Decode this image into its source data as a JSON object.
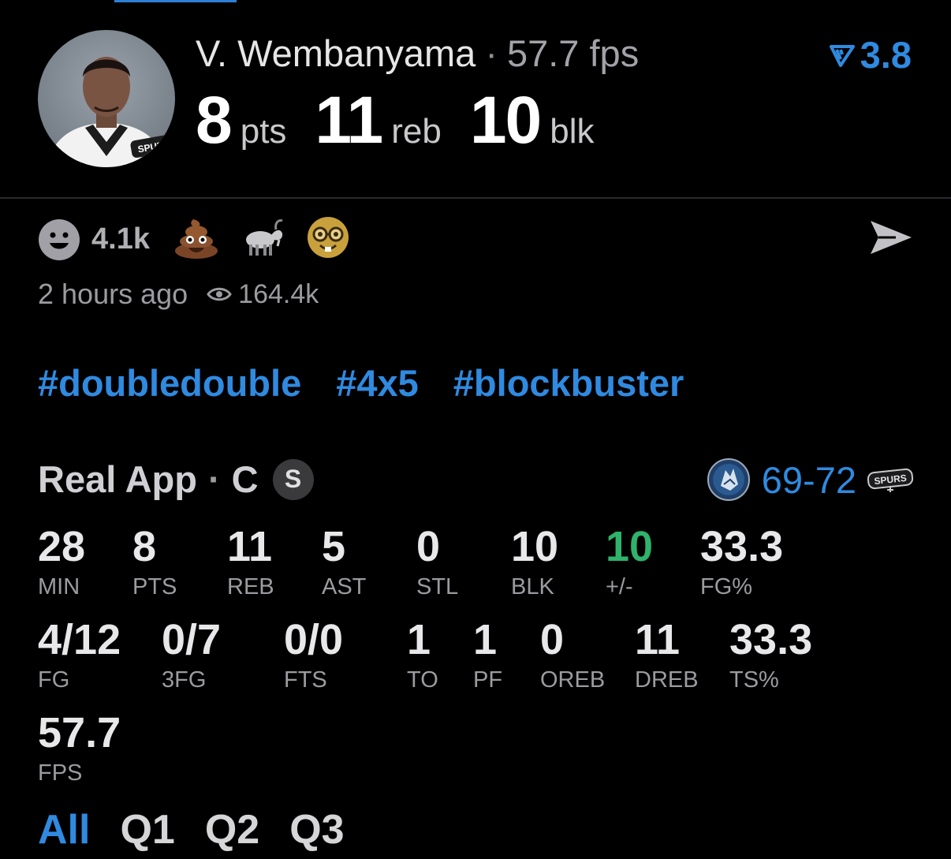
{
  "header": {
    "player_name": "V. Wembanyama",
    "fps_label": "57.7 fps",
    "rating": "3.8",
    "headline": [
      {
        "value": "8",
        "unit": "pts"
      },
      {
        "value": "11",
        "unit": "reb"
      },
      {
        "value": "10",
        "unit": "blk"
      }
    ]
  },
  "social": {
    "reaction_count": "4.1k",
    "time_ago": "2 hours ago",
    "views": "164.4k",
    "emojis": [
      "poop-emoji",
      "goat-emoji",
      "nerd-face-emoji"
    ]
  },
  "tags": [
    "#doubledouble",
    "#4x5",
    "#blockbuster"
  ],
  "game": {
    "source": "Real App",
    "position": "C",
    "badge": "S",
    "score": "69-72",
    "home_team_icon": "timberwolves-logo",
    "away_team_icon": "spurs-logo"
  },
  "stats_row1": [
    {
      "value": "28",
      "label": "MIN"
    },
    {
      "value": "8",
      "label": "PTS"
    },
    {
      "value": "11",
      "label": "REB"
    },
    {
      "value": "5",
      "label": "AST"
    },
    {
      "value": "0",
      "label": "STL"
    },
    {
      "value": "10",
      "label": "BLK"
    },
    {
      "value": "10",
      "label": "+/-"
    },
    {
      "value": "33.3",
      "label": "FG%"
    }
  ],
  "stats_row2": [
    {
      "value": "4/12",
      "label": "FG"
    },
    {
      "value": "0/7",
      "label": "3FG"
    },
    {
      "value": "0/0",
      "label": "FTS"
    },
    {
      "value": "1",
      "label": "TO"
    },
    {
      "value": "1",
      "label": "PF"
    },
    {
      "value": "0",
      "label": "OREB"
    },
    {
      "value": "11",
      "label": "DREB"
    },
    {
      "value": "33.3",
      "label": "TS%"
    }
  ],
  "stats_row3": [
    {
      "value": "57.7",
      "label": "FPS"
    }
  ],
  "quarters": {
    "items": [
      "All",
      "Q1",
      "Q2",
      "Q3"
    ],
    "active": "All"
  },
  "colors": {
    "accent_blue": "#2f8ae0",
    "positive_green": "#2fb36b",
    "background": "#000000"
  }
}
